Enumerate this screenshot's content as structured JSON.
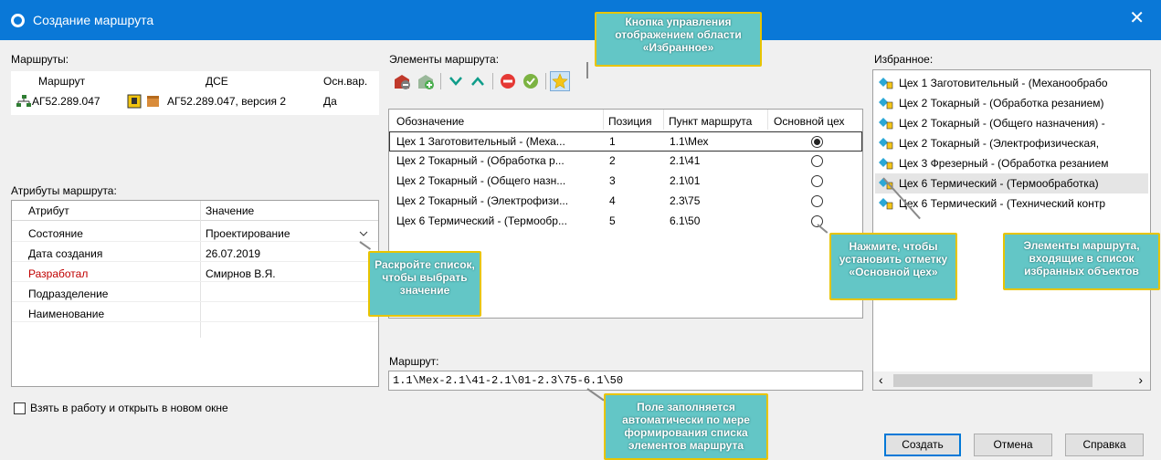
{
  "window": {
    "title": "Создание маршрута",
    "close_glyph": "✕"
  },
  "routes": {
    "label": "Маршруты:",
    "headers": [
      "Маршрут",
      "ДСЕ",
      "Осн.вар."
    ],
    "rows": [
      {
        "route": "АГ52.289.047",
        "dse": "АГ52.289.047, версия 2",
        "main": "Да"
      }
    ]
  },
  "attributes": {
    "label": "Атрибуты маршрута:",
    "headers": [
      "Атрибут",
      "Значение"
    ],
    "rows": [
      {
        "name": "Состояние",
        "value": "Проектирование",
        "required": false,
        "dropdown": true
      },
      {
        "name": "Дата создания",
        "value": "26.07.2019",
        "required": false,
        "dropdown": false
      },
      {
        "name": "Разработал",
        "value": "Смирнов В.Я.",
        "required": true,
        "dropdown": false
      },
      {
        "name": "Подразделение",
        "value": "",
        "required": false,
        "dropdown": false
      },
      {
        "name": "Наименование",
        "value": "",
        "required": false,
        "dropdown": false
      }
    ],
    "required_color": "#c00000"
  },
  "elements": {
    "label": "Элементы маршрута:",
    "headers": [
      "Обозначение",
      "Позиция",
      "Пункт маршрута",
      "Основной цех"
    ],
    "rows": [
      {
        "designation": "Цех 1 Заготовительный - (Меха...",
        "position": "1",
        "point": "1.1\\Мех",
        "main": true
      },
      {
        "designation": "Цех 2 Токарный - (Обработка р...",
        "position": "2",
        "point": "2.1\\41",
        "main": false
      },
      {
        "designation": "Цех 2 Токарный - (Общего назн...",
        "position": "3",
        "point": "2.1\\01",
        "main": false
      },
      {
        "designation": "Цех 2 Токарный - (Электрофизи...",
        "position": "4",
        "point": "2.3\\75",
        "main": false
      },
      {
        "designation": "Цех 6 Термический - (Термообр...",
        "position": "5",
        "point": "6.1\\50",
        "main": false
      }
    ]
  },
  "route_field": {
    "label": "Маршрут:",
    "value": "1.1\\Мех-2.1\\41-2.1\\01-2.3\\75-6.1\\50"
  },
  "favorites": {
    "label": "Избранное:",
    "items": [
      "Цех 1 Заготовительный - (Механообрабо",
      "Цех 2 Токарный - (Обработка резанием)",
      "Цех 2 Токарный - (Общего назначения) -",
      "Цех 2 Токарный - (Электрофизическая,",
      "Цех 3 Фрезерный - (Обработка резанием",
      "Цех 6 Термический - (Термообработка)",
      "Цех 6 Термический - (Технический контр"
    ],
    "selected_index": 5,
    "scroll_left": "‹",
    "scroll_right": "›"
  },
  "checkbox_label": "Взять в работу и открыть в новом окне",
  "buttons": {
    "create": "Создать",
    "cancel": "Отмена",
    "help": "Справка"
  },
  "callouts": {
    "favorites_toggle": "Кнопка управления отображением области «Избранное»",
    "dropdown": "Раскройте список, чтобы выбрать значение",
    "main_shop": "Нажмите, чтобы установить отметку «Основной цех»",
    "fav_elements": "Элементы маршрута, входящие в список избранных объектов",
    "route_field": "Поле заполняется автоматически по мере формирования списка элементов маршрута"
  },
  "colors": {
    "titlebar": "#0a78d7",
    "callout_fill": "#63c6c6",
    "callout_border": "#e8c400",
    "selected_row": "#e5e5e5"
  }
}
